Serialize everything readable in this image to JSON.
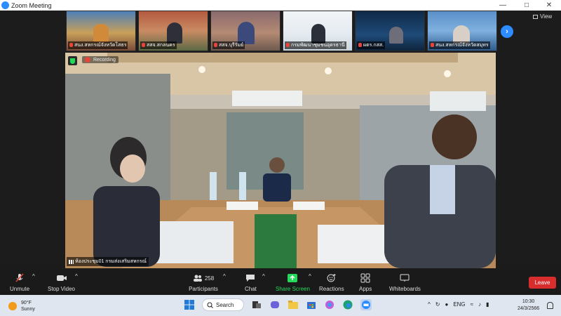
{
  "window": {
    "title": "Zoom Meeting",
    "controls": [
      "minimize-icon",
      "maximize-icon",
      "close-icon"
    ]
  },
  "view_button": {
    "label": "View"
  },
  "thumbnails": [
    {
      "name": "สนง.สหกรณ์จังหวัดโสธร",
      "bg": "#6b8fb8",
      "muted": true
    },
    {
      "name": "สสจ.สกลนคร",
      "bg": "#a05244",
      "muted": true
    },
    {
      "name": "สสจ.บุรีรัมย์",
      "bg": "#8d6b6a",
      "muted": true
    },
    {
      "name": "กรมพัฒนาชุมชนอุดรธานี",
      "bg": "#e8eef4",
      "muted": true
    },
    {
      "name": "ผตร.กสส.",
      "bg": "#1c3a5e",
      "muted": true
    },
    {
      "name": "สนง.สหกรณ์จังหวัดสมุทร",
      "bg": "#4f7fb8",
      "muted": true
    }
  ],
  "main_video": {
    "recording_label": "Recording",
    "speaker_name": "ห้องประชุม01 กรมส่งเสริมสหกรณ์"
  },
  "toolbar": {
    "unmute": "Unmute",
    "stop_video": "Stop Video",
    "participants": "Participants",
    "participant_count": "258",
    "chat": "Chat",
    "share_screen": "Share Screen",
    "reactions": "Reactions",
    "apps": "Apps",
    "whiteboards": "Whiteboards",
    "leave": "Leave"
  },
  "taskbar": {
    "weather_temp": "90°F",
    "weather_desc": "Sunny",
    "search_label": "Search",
    "language": "ENG",
    "time": "10:30",
    "date": "24/3/2566"
  },
  "colors": {
    "accent": "#2d8cff",
    "leave": "#d92d2d",
    "share": "#23d959",
    "record": "#e8443a"
  }
}
